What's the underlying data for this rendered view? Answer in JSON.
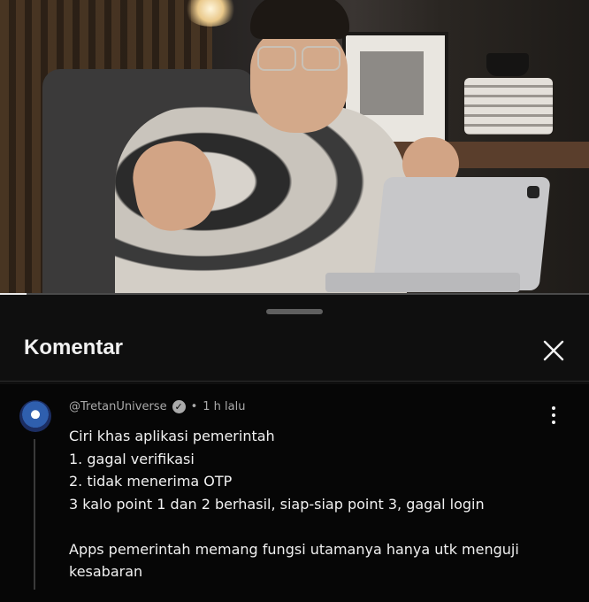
{
  "video": {
    "progress_fraction": 0.045
  },
  "comments_panel": {
    "title": "Komentar",
    "close_icon": "close-icon"
  },
  "comment": {
    "author": "@TretanUniverse",
    "verified": true,
    "separator": "•",
    "time": "1 h lalu",
    "lines": [
      "Ciri khas aplikasi pemerintah",
      "1. gagal verifikasi",
      "2. tidak menerima OTP",
      "3 kalo point 1 dan 2 berhasil, siap-siap point 3, gagal login",
      "",
      "Apps pemerintah memang fungsi utamanya hanya utk menguji",
      "kesabaran"
    ],
    "more_icon": "more-vert-icon"
  },
  "colors": {
    "background": "#0f0f0f",
    "text": "#f1f1f1",
    "meta": "#aaaaaa"
  }
}
